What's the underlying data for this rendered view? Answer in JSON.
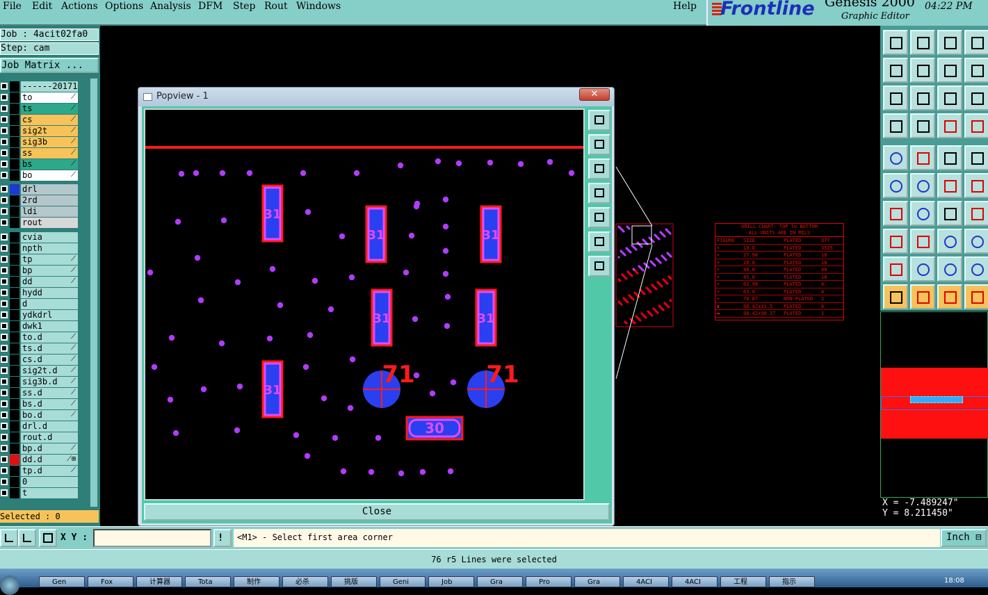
{
  "menu": {
    "items": [
      "File",
      "Edit",
      "Actions",
      "Options",
      "Analysis",
      "DFM",
      "Step",
      "Rout",
      "Windows"
    ],
    "help": "Help"
  },
  "logo": {
    "brand": "Frontline",
    "product": "Genesis 2000",
    "subtitle": "Graphic Editor",
    "clock": "04:22 PM"
  },
  "left": {
    "job": "Job : 4acit02fa0",
    "step": "Step: cam",
    "job_matrix": "Job Matrix ...",
    "selected": "Selected : 0",
    "layers": [
      {
        "name": "------20171",
        "bg": "#a8dcd6",
        "mk": ""
      },
      {
        "name": "to",
        "bg": "#ffffff",
        "mk": "⟋"
      },
      {
        "name": "ts",
        "bg": "#2da88a",
        "mk": "⟋"
      },
      {
        "name": "cs",
        "bg": "#f6c35a",
        "mk": "⟋"
      },
      {
        "name": "sig2t",
        "bg": "#f6c35a",
        "mk": "⟋"
      },
      {
        "name": "sig3b",
        "bg": "#f6c35a",
        "mk": "⟋"
      },
      {
        "name": "ss",
        "bg": "#f6c35a",
        "mk": "⟋"
      },
      {
        "name": "bs",
        "bg": "#2da88a",
        "mk": "⟋"
      },
      {
        "name": "bo",
        "bg": "#ffffff",
        "mk": "⟋"
      },
      {
        "name": "drl",
        "bg": "#b4c8cc",
        "mk": "",
        "sw": "#1a3ad0"
      },
      {
        "name": "2rd",
        "bg": "#b4c8cc",
        "mk": ""
      },
      {
        "name": "ldi",
        "bg": "#b4c8cc",
        "mk": ""
      },
      {
        "name": "rout",
        "bg": "#d8d8d8",
        "mk": ""
      },
      {
        "name": "cvia",
        "bg": "#a8dcd6",
        "mk": ""
      },
      {
        "name": "npth",
        "bg": "#a8dcd6",
        "mk": ""
      },
      {
        "name": "tp",
        "bg": "#a8dcd6",
        "mk": "⟋"
      },
      {
        "name": "bp",
        "bg": "#a8dcd6",
        "mk": "⟋"
      },
      {
        "name": "dd",
        "bg": "#a8dcd6",
        "mk": "⟋"
      },
      {
        "name": "hydd",
        "bg": "#a8dcd6",
        "mk": ""
      },
      {
        "name": "d",
        "bg": "#a8dcd6",
        "mk": ""
      },
      {
        "name": "ydkdrl",
        "bg": "#a8dcd6",
        "mk": ""
      },
      {
        "name": "dwk1",
        "bg": "#a8dcd6",
        "mk": ""
      },
      {
        "name": "to.d",
        "bg": "#a8dcd6",
        "mk": "⟋"
      },
      {
        "name": "ts.d",
        "bg": "#a8dcd6",
        "mk": "⟋"
      },
      {
        "name": "cs.d",
        "bg": "#a8dcd6",
        "mk": "⟋"
      },
      {
        "name": "sig2t.d",
        "bg": "#a8dcd6",
        "mk": "⟋"
      },
      {
        "name": "sig3b.d",
        "bg": "#a8dcd6",
        "mk": "⟋"
      },
      {
        "name": "ss.d",
        "bg": "#a8dcd6",
        "mk": "⟋"
      },
      {
        "name": "bs.d",
        "bg": "#a8dcd6",
        "mk": "⟋"
      },
      {
        "name": "bo.d",
        "bg": "#a8dcd6",
        "mk": "⟋"
      },
      {
        "name": "drl.d",
        "bg": "#a8dcd6",
        "mk": ""
      },
      {
        "name": "rout.d",
        "bg": "#a8dcd6",
        "mk": ""
      },
      {
        "name": "bp.d",
        "bg": "#a8dcd6",
        "mk": "⟋"
      },
      {
        "name": "dd.d",
        "bg": "#a8dcd6",
        "mk": "⟋⊞",
        "sw": "#e01010"
      },
      {
        "name": "tp.d",
        "bg": "#a8dcd6",
        "mk": "⟋"
      },
      {
        "name": "0",
        "bg": "#a8dcd6",
        "mk": ""
      },
      {
        "name": "t",
        "bg": "#a8dcd6",
        "mk": ""
      }
    ]
  },
  "popup": {
    "title": "Popview - 1",
    "close_x": "✕",
    "close_button": "Close",
    "pad_labels": [
      "31",
      "31",
      "31",
      "31",
      "31",
      "31",
      "30"
    ],
    "circle_labels": [
      "71",
      "71"
    ]
  },
  "drill_chart": {
    "title1": "DRILL CHART: TOP to BOTTOM",
    "title2": "ALL UNITS ARE IN MILS",
    "headers": [
      "FIGURE",
      "SIZE",
      "PLATED",
      "QTY"
    ],
    "rows": [
      [
        "•",
        "10.0",
        "PLATED",
        "3525"
      ],
      [
        "•",
        "27.98",
        "PLATED",
        "18"
      ],
      [
        "•",
        "28.0",
        "PLATED",
        "18"
      ],
      [
        "•",
        "40.0",
        "PLATED",
        "48"
      ],
      [
        "•",
        "45.0",
        "PLATED",
        "18"
      ],
      [
        "•",
        "62.98",
        "PLATED",
        "4"
      ],
      [
        "•",
        "63.0",
        "PLATED",
        "4"
      ],
      [
        "•",
        "70.87",
        "NON-PLATED",
        "2"
      ],
      [
        "▮",
        "98.42x31.5",
        "PLATED",
        "6"
      ],
      [
        "▬",
        "98.42x98.37",
        "PLATED",
        "1"
      ]
    ]
  },
  "coords": {
    "x": "X = -7.489247\"",
    "y": "Y = 8.211450\""
  },
  "cmd": {
    "xy_label": "X Y :",
    "xy_value": "",
    "prompt": "<M1> - Select first area corner",
    "unit": "Inch ⊟"
  },
  "status": "76 r5 Lines were selected",
  "taskbar": [
    "Gen",
    "Fox",
    "计算器",
    "Tota",
    "制作",
    "必杀",
    "挑版",
    "Geni",
    "Job",
    "Gra",
    "Pro",
    "Gra",
    "4ACI",
    "4ACI",
    "工程",
    "指示"
  ],
  "tray_time": "18:08",
  "colors": {
    "accent": "#86cec8",
    "pad_fill": "#2a3ff0",
    "pad_outline": "#ff1a1a",
    "via": "#b23bff"
  }
}
